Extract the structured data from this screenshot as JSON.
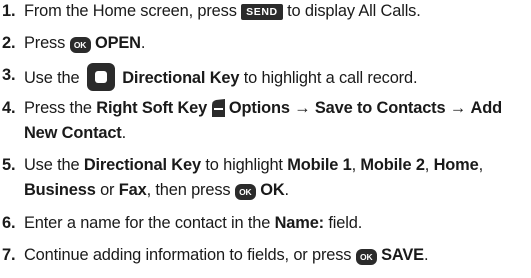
{
  "steps": [
    {
      "num": "1.",
      "t1": "From the Home screen, press ",
      "key": "SEND",
      "t2": " to display All Calls."
    },
    {
      "num": "2.",
      "t1": "Press ",
      "key": "OK",
      "b1": "OPEN",
      "t2": "."
    },
    {
      "num": "3.",
      "t1": "Use the ",
      "b1": "Directional Key",
      "t2": " to highlight a call record."
    },
    {
      "num": "4.",
      "t1": "Press the ",
      "b1": "Right Soft Key",
      "b2": "Options",
      "arrow1": "→",
      "b3": "Save to Contacts",
      "arrow2": "→",
      "b4": "Add",
      "b5": "New Contact",
      "t2": "."
    },
    {
      "num": "5.",
      "t1": "Use the ",
      "b1": "Directional Key",
      "t2": " to highlight ",
      "b2": "Mobile 1",
      "t3": ", ",
      "b3": "Mobile 2",
      "t4": ", ",
      "b4": "Home",
      "t5": ",",
      "b5": "Business",
      "t6": " or ",
      "b6": "Fax",
      "t7": ", then press ",
      "key": "OK",
      "b7": "OK",
      "t8": "."
    },
    {
      "num": "6.",
      "t1": "Enter a name for the contact in the ",
      "b1": "Name:",
      "t2": " field."
    },
    {
      "num": "7.",
      "t1": "Continue adding information to fields, or press ",
      "key": "OK",
      "b1": "SAVE",
      "t2": "."
    }
  ],
  "icons": {
    "send_key": "send-key-icon",
    "ok_key": "ok-key-icon",
    "directional_key": "directional-key-icon",
    "right_soft_key": "right-soft-key-icon"
  },
  "colors": {
    "key_fill": "#2b2b2b",
    "text": "#1a1a1a",
    "key_text": "#ffffff"
  }
}
